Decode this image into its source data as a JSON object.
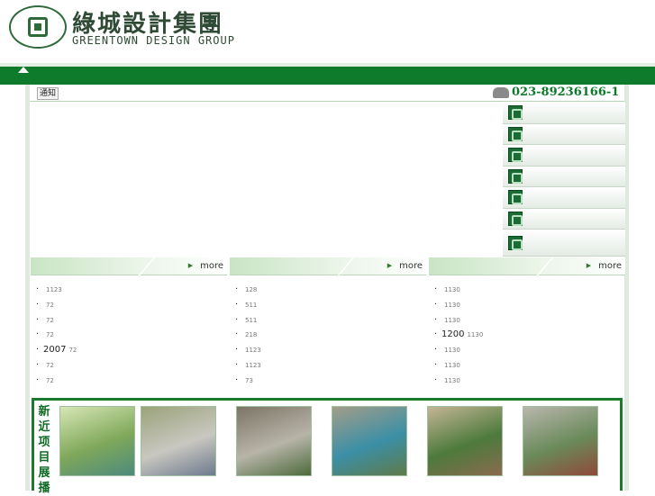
{
  "header": {
    "logo_cn": "綠城設計集團",
    "logo_en": "GREENTOWN DESIGN GROUP",
    "nav": [
      "",
      "",
      "",
      "",
      "",
      "",
      "",
      "",
      "",
      ""
    ]
  },
  "notice": {
    "tab_label": "通知",
    "hotline_label": "",
    "hotline_number": "023-89236166-1"
  },
  "side_menu": [
    "",
    "",
    "",
    "",
    "",
    "",
    ""
  ],
  "columns": [
    {
      "title": "",
      "more": "more",
      "items": [
        {
          "text": "",
          "date": "1123",
          "red": false
        },
        {
          "text": "",
          "date": "72",
          "red": false
        },
        {
          "text": "",
          "date": "72",
          "red": false
        },
        {
          "text": "",
          "date": "72",
          "red": false
        },
        {
          "text": "2007",
          "date": "72",
          "red": false
        },
        {
          "text": "",
          "date": "72",
          "red": false
        },
        {
          "text": "",
          "date": "72",
          "red": false
        }
      ]
    },
    {
      "title": "",
      "more": "more",
      "items": [
        {
          "text": "",
          "date": "128",
          "red": true
        },
        {
          "text": "",
          "date": "511",
          "red": true
        },
        {
          "text": "",
          "date": "511",
          "red": false
        },
        {
          "text": "",
          "date": "218",
          "red": false
        },
        {
          "text": "",
          "date": "1123",
          "red": true
        },
        {
          "text": "",
          "date": "1123",
          "red": true
        },
        {
          "text": "",
          "date": "73",
          "red": false
        }
      ]
    },
    {
      "title": "",
      "more": "more",
      "items": [
        {
          "text": "",
          "date": "1130",
          "red": false
        },
        {
          "text": "",
          "date": "1130",
          "red": false
        },
        {
          "text": "",
          "date": "1130",
          "red": false
        },
        {
          "text": "1200",
          "date": "1130",
          "red": false
        },
        {
          "text": "",
          "date": "1130",
          "red": false
        },
        {
          "text": "",
          "date": "1130",
          "red": false
        },
        {
          "text": "",
          "date": "1130",
          "red": false
        }
      ]
    }
  ],
  "showcase": {
    "title": "新近项目展播",
    "items": [
      {
        "caption": "",
        "colors": [
          "#d7e6b5",
          "#7fa85a",
          "#4d8a7e"
        ]
      },
      {
        "caption": "",
        "colors": [
          "#9aa37a",
          "#c9c7c0",
          "#6d7a8f"
        ]
      },
      {
        "caption": "",
        "colors": [
          "#7c7566",
          "#b7b4a8",
          "#4d6a3c"
        ]
      },
      {
        "caption": "",
        "colors": [
          "#a39d89",
          "#3b8fa6",
          "#5f7a4a"
        ]
      },
      {
        "caption": "",
        "colors": [
          "#c4b595",
          "#4d7a3c",
          "#8a6a4f"
        ]
      },
      {
        "caption": "",
        "colors": [
          "#b9b6ad",
          "#6a8a5a",
          "#8f4a3a"
        ]
      }
    ]
  },
  "colors": {
    "brand_green": "#0e7a2c",
    "accent_red": "#d40000"
  }
}
